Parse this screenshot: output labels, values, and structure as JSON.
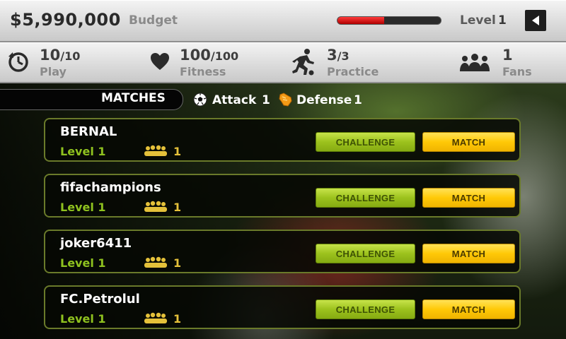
{
  "top_bar": {
    "budget_amount": "$5,990,000",
    "budget_label": "Budget",
    "level_progress_fraction": 0.45,
    "level_label": "Level",
    "level_value": "1",
    "back_icon": "back-arrow-icon"
  },
  "stats": [
    {
      "key": "play",
      "icon": "clock-icon",
      "value": "10",
      "max": "/10",
      "label": "Play"
    },
    {
      "key": "fitness",
      "icon": "heart-icon",
      "value": "100",
      "max": "/100",
      "label": "Fitness"
    },
    {
      "key": "practice",
      "icon": "running-player-icon",
      "value": "3",
      "max": "/3",
      "label": "Practice"
    },
    {
      "key": "fans",
      "icon": "fans-icon",
      "value": "1",
      "max": "",
      "label": "Fans"
    }
  ],
  "matches_header": {
    "tab_label": "MATCHES",
    "attack_label": "Attack",
    "attack_value": "1",
    "defense_label": "Defense",
    "defense_value": "1"
  },
  "opponents": [
    {
      "name": "BERNAL",
      "level": "Level 1",
      "fans": "1",
      "challenge": "CHALLENGE",
      "match": "MATCH"
    },
    {
      "name": "fifachampions",
      "level": "Level 1",
      "fans": "1",
      "challenge": "CHALLENGE",
      "match": "MATCH"
    },
    {
      "name": "joker6411",
      "level": "Level 1",
      "fans": "1",
      "challenge": "CHALLENGE",
      "match": "MATCH"
    },
    {
      "name": "FC.Petrolul",
      "level": "Level 1",
      "fans": "1",
      "challenge": "CHALLENGE",
      "match": "MATCH"
    }
  ],
  "colors": {
    "challenge_button": "#9cc21d",
    "match_button": "#ffc907",
    "level_bar": "#d01010",
    "level_text": "#8fc21f"
  }
}
